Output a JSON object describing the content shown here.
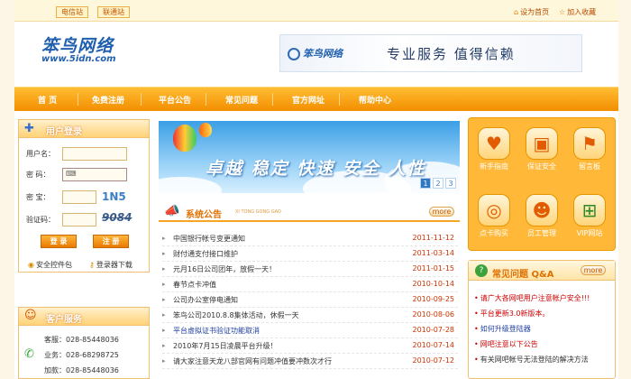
{
  "topbar": {
    "btn_call": "电信站",
    "btn_new": "联通站",
    "set_home": "设为首页",
    "add_fav": "加入收藏"
  },
  "logo": {
    "main": "笨鸟网络",
    "sub": "www.5idn.com"
  },
  "banner": {
    "logo": "笨鸟网络",
    "slogan": "专业服务   值得信赖"
  },
  "nav": [
    "首  页",
    "免费注册",
    "平台公告",
    "常见问题",
    "官方网址",
    "帮助中心"
  ],
  "login": {
    "title": "用户登录",
    "username_label": "用户名：",
    "password_label": "密  码：",
    "password_hint": "⌨",
    "secret_label": "密  宝：",
    "secret_code": "1N5",
    "captcha_label": "验证码：",
    "captcha_code": "9084",
    "login_btn": "登  录",
    "register_btn": "注  册",
    "security_plugin": "安全控件包",
    "login_download": "登录器下载"
  },
  "service": {
    "title": "客户服务",
    "lines": [
      "客服：028-85448036",
      "业务：028-68298725",
      "加款：028-85448036"
    ]
  },
  "hero": {
    "slogan": "卓越  稳定  快速  安全  人性",
    "pages": [
      "1",
      "2",
      "3"
    ]
  },
  "notice": {
    "title": "系统公告",
    "subtitle": "XI TONG GONG GAO",
    "more": "more",
    "items": [
      {
        "text": "中国银行帐号变更通知",
        "date": "2011-11-12"
      },
      {
        "text": "财付通支付接口维护",
        "date": "2011-03-14"
      },
      {
        "text": "元月16日公司团年，放假一天！",
        "date": "2011-01-15"
      },
      {
        "text": "春节点卡冲值",
        "date": "2010-10-14"
      },
      {
        "text": "公司办公室停电通知",
        "date": "2010-09-25"
      },
      {
        "text": "笨鸟公司2010.8.8集体活动，休假一天",
        "date": "2010-08-06"
      },
      {
        "text": "平台虚拟证书验证功能取消",
        "date": "2010-07-28"
      },
      {
        "text": "2010年7月15日凌晨平台升级！",
        "date": "2010-07-14"
      },
      {
        "text": "请大家注意天龙八部官网有问题冲值要冲数次才行",
        "date": "2010-07-12"
      }
    ]
  },
  "services": [
    {
      "label": "新手指南",
      "icon": "heart-icon"
    },
    {
      "label": "保证安全",
      "icon": "safe-icon"
    },
    {
      "label": "留言板",
      "icon": "flag-icon"
    },
    {
      "label": "点卡购买",
      "icon": "coins-icon"
    },
    {
      "label": "员工管理",
      "icon": "staff-icon"
    },
    {
      "label": "VIP网站",
      "icon": "network-icon"
    }
  ],
  "faq": {
    "title": "常见问题 Q&A",
    "more": "more",
    "items": [
      {
        "text": "请广大各网吧用户注意帐户安全!!!",
        "color": "#cc0000"
      },
      {
        "text": "平台更新3.0新版本。",
        "color": "#cc0000"
      },
      {
        "text": "如何升级登陆器",
        "color": "#2040a0"
      },
      {
        "text": "网吧注意以下公告",
        "color": "#cc0000"
      },
      {
        "text": "有关网吧帐号无法登陆的解决方法",
        "color": "#333333"
      }
    ]
  }
}
